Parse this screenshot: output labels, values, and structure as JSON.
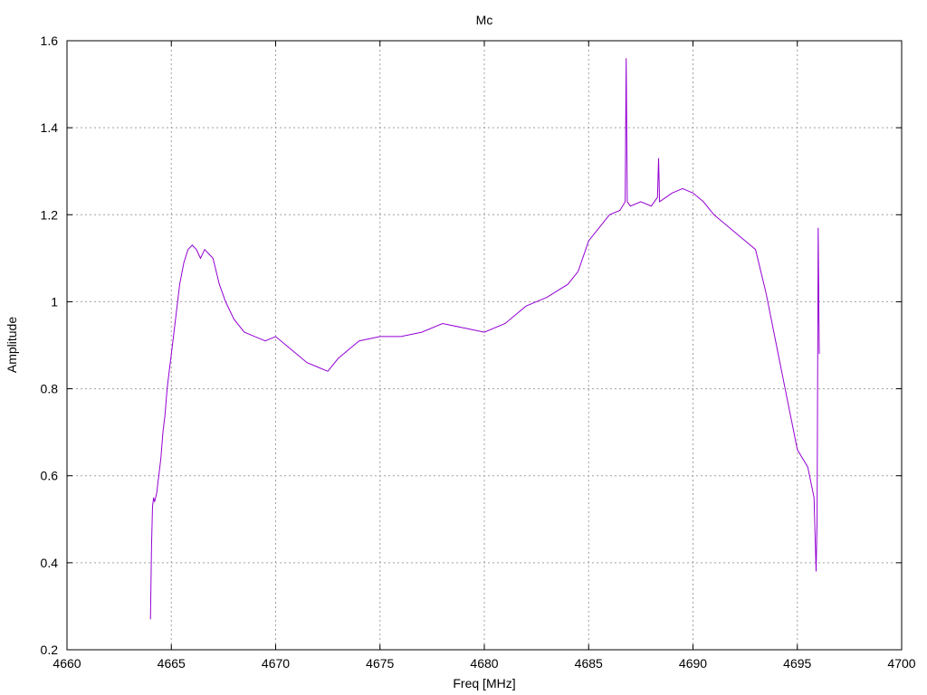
{
  "chart_data": {
    "type": "line",
    "title": "Mc",
    "xlabel": "Freq [MHz]",
    "ylabel": "Amplitude",
    "xlim": [
      4660,
      4700
    ],
    "ylim": [
      0.2,
      1.6
    ],
    "xticks": [
      4660,
      4665,
      4670,
      4675,
      4680,
      4685,
      4690,
      4695,
      4700
    ],
    "xtick_labels": [
      "4660",
      "4665",
      "4670",
      "4675",
      "4680",
      "4685",
      "4690",
      "4695",
      "4700"
    ],
    "yticks": [
      0.2,
      0.4,
      0.6,
      0.8,
      1.0,
      1.2,
      1.4,
      1.6
    ],
    "ytick_labels": [
      "0.2",
      "0.4",
      "0.6",
      "0.8",
      "1",
      "1.2",
      "1.4",
      "1.6"
    ],
    "grid": true,
    "series": [
      {
        "color": "#9400d3",
        "x": [
          4664.0,
          4664.05,
          4664.1,
          4664.15,
          4664.2,
          4664.3,
          4664.4,
          4664.5,
          4664.6,
          4664.7,
          4664.8,
          4664.9,
          4665.0,
          4665.2,
          4665.4,
          4665.6,
          4665.8,
          4666.0,
          4666.2,
          4666.4,
          4666.6,
          4666.8,
          4667.0,
          4667.3,
          4667.6,
          4668.0,
          4668.5,
          4669.0,
          4669.5,
          4670.0,
          4670.5,
          4671.0,
          4671.5,
          4672.0,
          4672.5,
          4673.0,
          4673.5,
          4674.0,
          4675.0,
          4676.0,
          4677.0,
          4678.0,
          4679.0,
          4680.0,
          4681.0,
          4682.0,
          4683.0,
          4684.0,
          4684.5,
          4685.0,
          4685.5,
          4686.0,
          4686.5,
          4686.75,
          4686.8,
          4686.85,
          4687.0,
          4687.5,
          4688.0,
          4688.3,
          4688.35,
          4688.4,
          4689.0,
          4689.5,
          4690.0,
          4690.5,
          4691.0,
          4691.5,
          4692.0,
          4692.5,
          4693.0,
          4693.5,
          4694.0,
          4694.5,
          4695.0,
          4695.5,
          4695.8,
          4695.9,
          4695.95,
          4696.0,
          4696.05
        ],
        "y": [
          0.27,
          0.44,
          0.53,
          0.55,
          0.54,
          0.56,
          0.6,
          0.64,
          0.7,
          0.74,
          0.8,
          0.84,
          0.88,
          0.96,
          1.04,
          1.09,
          1.12,
          1.13,
          1.12,
          1.1,
          1.12,
          1.11,
          1.1,
          1.04,
          1.0,
          0.96,
          0.93,
          0.92,
          0.91,
          0.92,
          0.9,
          0.88,
          0.86,
          0.85,
          0.84,
          0.87,
          0.89,
          0.91,
          0.92,
          0.92,
          0.93,
          0.95,
          0.94,
          0.93,
          0.95,
          0.99,
          1.01,
          1.04,
          1.07,
          1.14,
          1.17,
          1.2,
          1.21,
          1.23,
          1.56,
          1.23,
          1.22,
          1.23,
          1.22,
          1.24,
          1.33,
          1.23,
          1.25,
          1.26,
          1.25,
          1.23,
          1.2,
          1.18,
          1.16,
          1.14,
          1.12,
          1.02,
          0.9,
          0.78,
          0.66,
          0.62,
          0.55,
          0.38,
          0.5,
          1.17,
          0.88
        ]
      }
    ]
  }
}
